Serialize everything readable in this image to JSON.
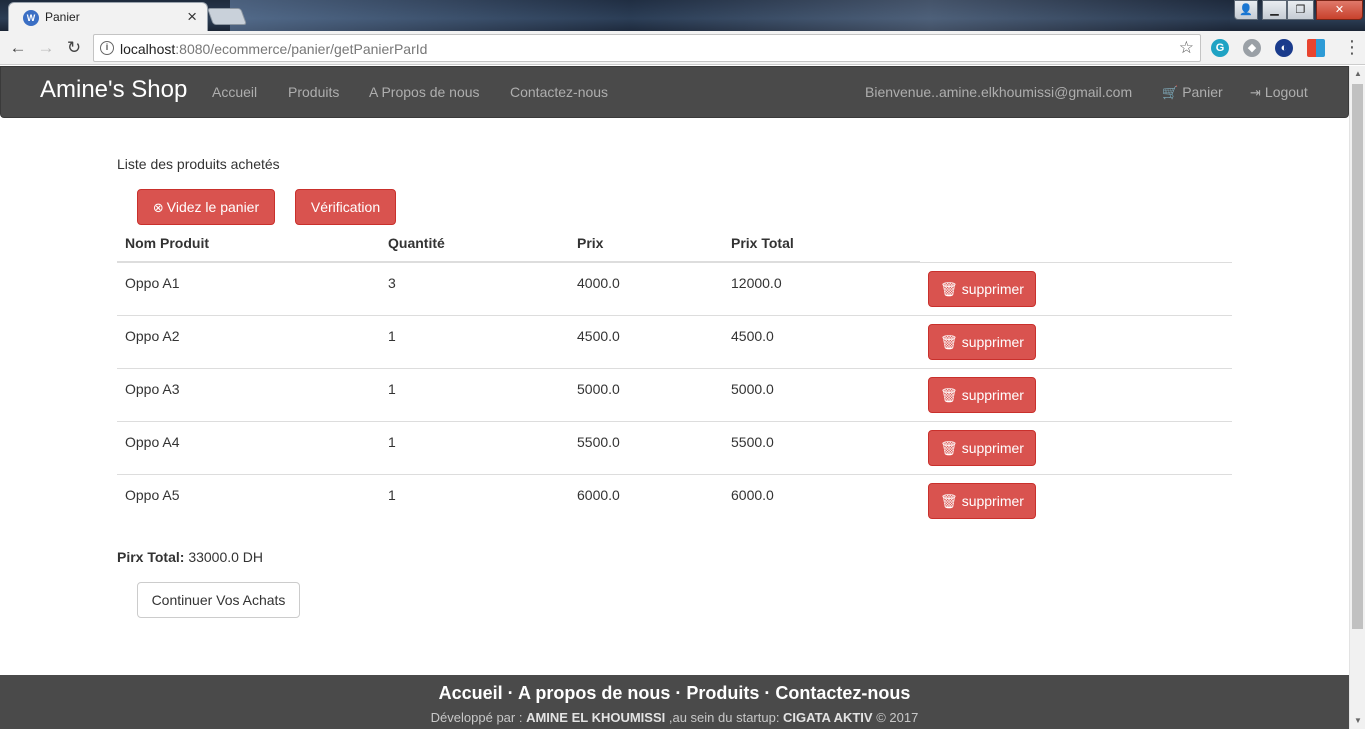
{
  "browser": {
    "tab_title": "Panier",
    "url_host": "localhost",
    "url_rest": ":8080/ecommerce/panier/getPanierParId"
  },
  "navbar": {
    "brand": "Amine's Shop",
    "links": [
      "Accueil",
      "Produits",
      "A Propos de nous",
      "Contactez-nous"
    ],
    "welcome": "Bienvenue..amine.elkhoumissi@gmail.com",
    "cart_label": "Panier",
    "logout_label": "Logout"
  },
  "main": {
    "list_title": "Liste des produits achetés",
    "empty_cart_label": "Videz le panier",
    "verify_label": "Vérification",
    "columns": [
      "Nom Produit",
      "Quantité",
      "Prix",
      "Prix Total"
    ],
    "rows": [
      {
        "name": "Oppo A1",
        "qty": "3",
        "price": "4000.0",
        "total": "12000.0"
      },
      {
        "name": "Oppo A2",
        "qty": "1",
        "price": "4500.0",
        "total": "4500.0"
      },
      {
        "name": "Oppo A3",
        "qty": "1",
        "price": "5000.0",
        "total": "5000.0"
      },
      {
        "name": "Oppo A4",
        "qty": "1",
        "price": "5500.0",
        "total": "5500.0"
      },
      {
        "name": "Oppo A5",
        "qty": "1",
        "price": "6000.0",
        "total": "6000.0"
      }
    ],
    "delete_label": "supprimer",
    "total_label": "Pirx Total:",
    "total_value": "33000.0 DH",
    "continue_label": "Continuer Vos Achats"
  },
  "footer": {
    "links": "Accueil · A propos de nous · Produits · Contactez-nous",
    "credits_prefix": "Développé par : ",
    "author": "AMINE EL KHOUMISSI",
    "credits_middle": " ,au sein du startup: ",
    "startup": "CIGATA AKTIV",
    "credits_suffix": " © 2017"
  },
  "colors": {
    "navbar_bg": "#4a4a4a",
    "danger": "#d9534f",
    "footer_bg": "#4a4a4a"
  }
}
